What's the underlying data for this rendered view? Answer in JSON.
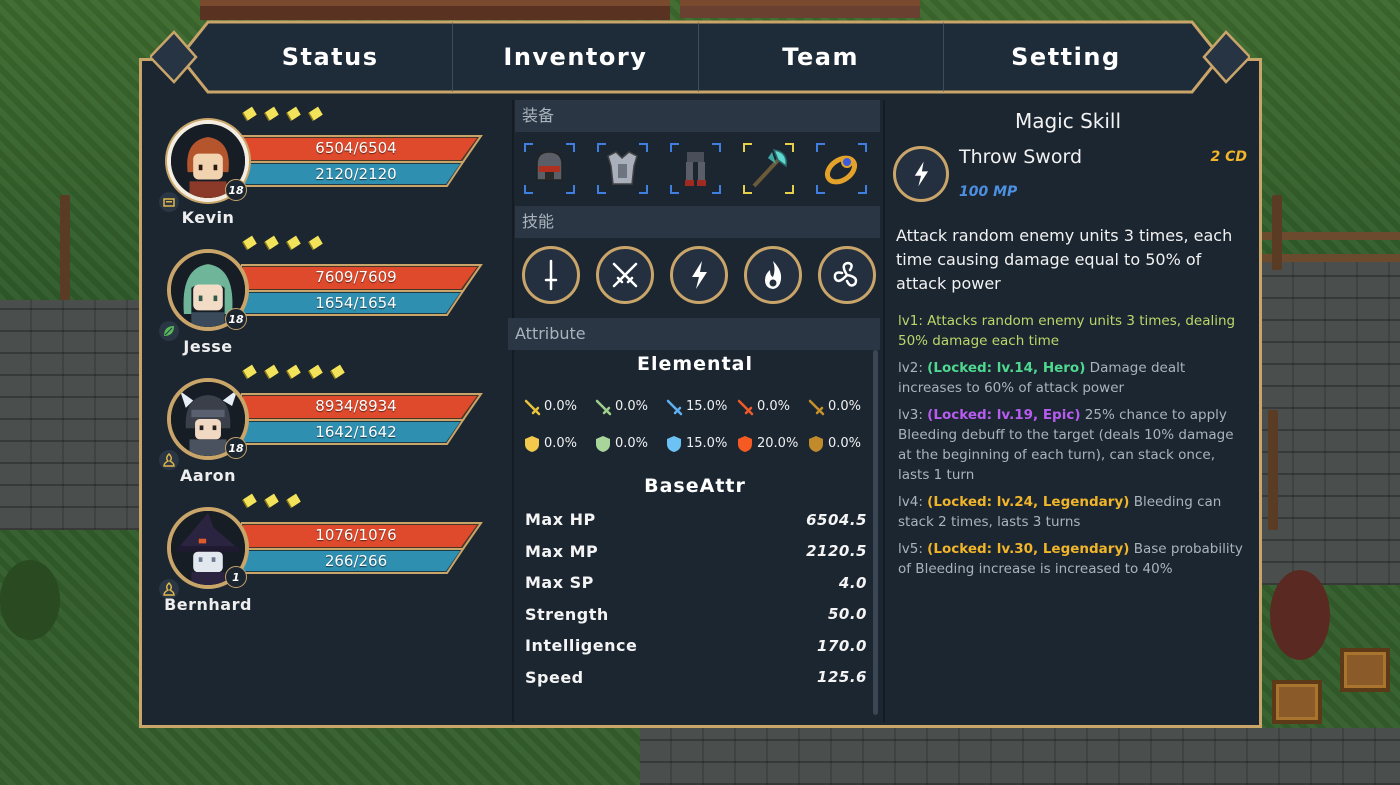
{
  "tabs": [
    "Status",
    "Inventory",
    "Team",
    "Setting"
  ],
  "team": [
    {
      "name": "Kevin",
      "hp": "6504/6504",
      "mp": "2120/2120",
      "level": "18",
      "stars": 4,
      "hp_fill": 1.0,
      "mp_fill": 1.0,
      "selected": true,
      "class_icon": "card-icon"
    },
    {
      "name": "Jesse",
      "hp": "7609/7609",
      "mp": "1654/1654",
      "level": "18",
      "stars": 4,
      "hp_fill": 1.0,
      "mp_fill": 1.0,
      "selected": false,
      "class_icon": "leaf-icon"
    },
    {
      "name": "Aaron",
      "hp": "8934/8934",
      "mp": "1642/1642",
      "level": "18",
      "stars": 5,
      "hp_fill": 1.0,
      "mp_fill": 1.0,
      "selected": false,
      "class_icon": "crest-icon"
    },
    {
      "name": "Bernhard",
      "hp": "1076/1076",
      "mp": "266/266",
      "level": "1",
      "stars": 3,
      "hp_fill": 1.0,
      "mp_fill": 1.0,
      "selected": false,
      "class_icon": "crest-icon"
    }
  ],
  "middle": {
    "equip_header": "装备",
    "skills_header": "技能",
    "attribute_header": "Attribute",
    "equipment": [
      "helmet-icon",
      "armor-icon",
      "greaves-icon",
      "axe-icon",
      "ring-icon"
    ],
    "skills": [
      "sword-skill-icon",
      "crossed-swords-skill-icon",
      "lightning-skill-icon",
      "fire-skill-icon",
      "triskelion-skill-icon"
    ],
    "elemental_title": "Elemental",
    "elemental_attack": [
      {
        "icon": "sword-yellow-icon",
        "color": "#e7c23a",
        "value": "0.0%"
      },
      {
        "icon": "sword-green-icon",
        "color": "#9fcf8a",
        "value": "0.0%"
      },
      {
        "icon": "sword-blue-icon",
        "color": "#5fb0ef",
        "value": "15.0%"
      },
      {
        "icon": "sword-red-icon",
        "color": "#f05a28",
        "value": "0.0%"
      },
      {
        "icon": "sword-brown-icon",
        "color": "#c7912a",
        "value": "0.0%"
      }
    ],
    "elemental_defense": [
      {
        "icon": "shield-yellow-icon",
        "color": "#f2c94c",
        "value": "0.0%"
      },
      {
        "icon": "shield-green-icon",
        "color": "#a8d69a",
        "value": "0.0%"
      },
      {
        "icon": "shield-blue-icon",
        "color": "#6cc2f5",
        "value": "15.0%"
      },
      {
        "icon": "shield-red-icon",
        "color": "#f55a22",
        "value": "20.0%"
      },
      {
        "icon": "shield-brown-icon",
        "color": "#c18a2a",
        "value": "0.0%"
      }
    ],
    "base_title": "BaseAttr",
    "base": [
      {
        "label": "Max HP",
        "value": "6504.5"
      },
      {
        "label": "Max MP",
        "value": "2120.5"
      },
      {
        "label": "Max SP",
        "value": "4.0"
      },
      {
        "label": "Strength",
        "value": "50.0"
      },
      {
        "label": "Intelligence",
        "value": "170.0"
      },
      {
        "label": "Speed",
        "value": "125.6"
      }
    ]
  },
  "skill_detail": {
    "title": "Magic Skill",
    "name": "Throw Sword",
    "cd": "2 CD",
    "mp": "100 MP",
    "icon": "lightning-skill-icon",
    "description": "Attack random enemy units 3 times, each time causing damage equal to 50% of attack power",
    "levels": [
      {
        "prefix": "lv1: ",
        "locked": "",
        "rarity": "",
        "text": "Attacks random enemy units 3 times, dealing 50% damage each time",
        "active": true
      },
      {
        "prefix": "lv2: ",
        "locked": "(Locked: lv.14, Hero)",
        "rarity": "hero",
        "text": " Damage dealt increases to 60% of attack power",
        "active": false
      },
      {
        "prefix": "lv3: ",
        "locked": "(Locked: lv.19, Epic)",
        "rarity": "epic",
        "text": " 25% chance to apply Bleeding debuff to the target (deals 10% damage at the beginning of each turn), can stack once, lasts 1 turn",
        "active": false
      },
      {
        "prefix": "lv4: ",
        "locked": "(Locked: lv.24, Legendary)",
        "rarity": "leg",
        "text": " Bleeding can stack 2 times, lasts 3 turns",
        "active": false
      },
      {
        "prefix": "lv5: ",
        "locked": "(Locked: lv.30, Legendary)",
        "rarity": "leg",
        "text": " Base probability of Bleeding increase is increased to 40%",
        "active": false
      }
    ]
  },
  "colors": {
    "panel": "#1c2631",
    "gold_border": "#c9a56a",
    "hp": "#e04a2c",
    "mp": "#2f8fb0",
    "lv_active": "#b8d96a"
  }
}
